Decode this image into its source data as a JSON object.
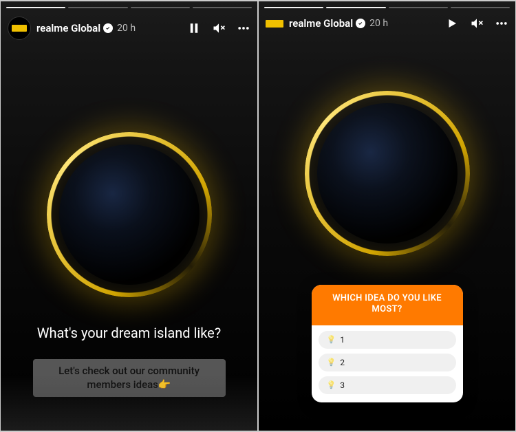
{
  "left": {
    "segments": 4,
    "segments_done": 1,
    "account": "realme Global",
    "verified": true,
    "time": "20 h",
    "controls": {
      "play_state": "pause",
      "muted": true
    },
    "question": "What's your dream island like?",
    "caption": "Let's check out our community members ideas👉"
  },
  "right": {
    "segments": 4,
    "segments_done": 2,
    "account": "realme Global",
    "verified": true,
    "time": "20 h",
    "controls": {
      "play_state": "play",
      "muted": true
    },
    "poll": {
      "title": "WHICH IDEA DO YOU LIKE MOST?",
      "options": [
        "1",
        "2",
        "3"
      ]
    }
  },
  "colors": {
    "accent": "#ff7a00",
    "ring": "#ffc800",
    "brand": "#f0c000"
  }
}
